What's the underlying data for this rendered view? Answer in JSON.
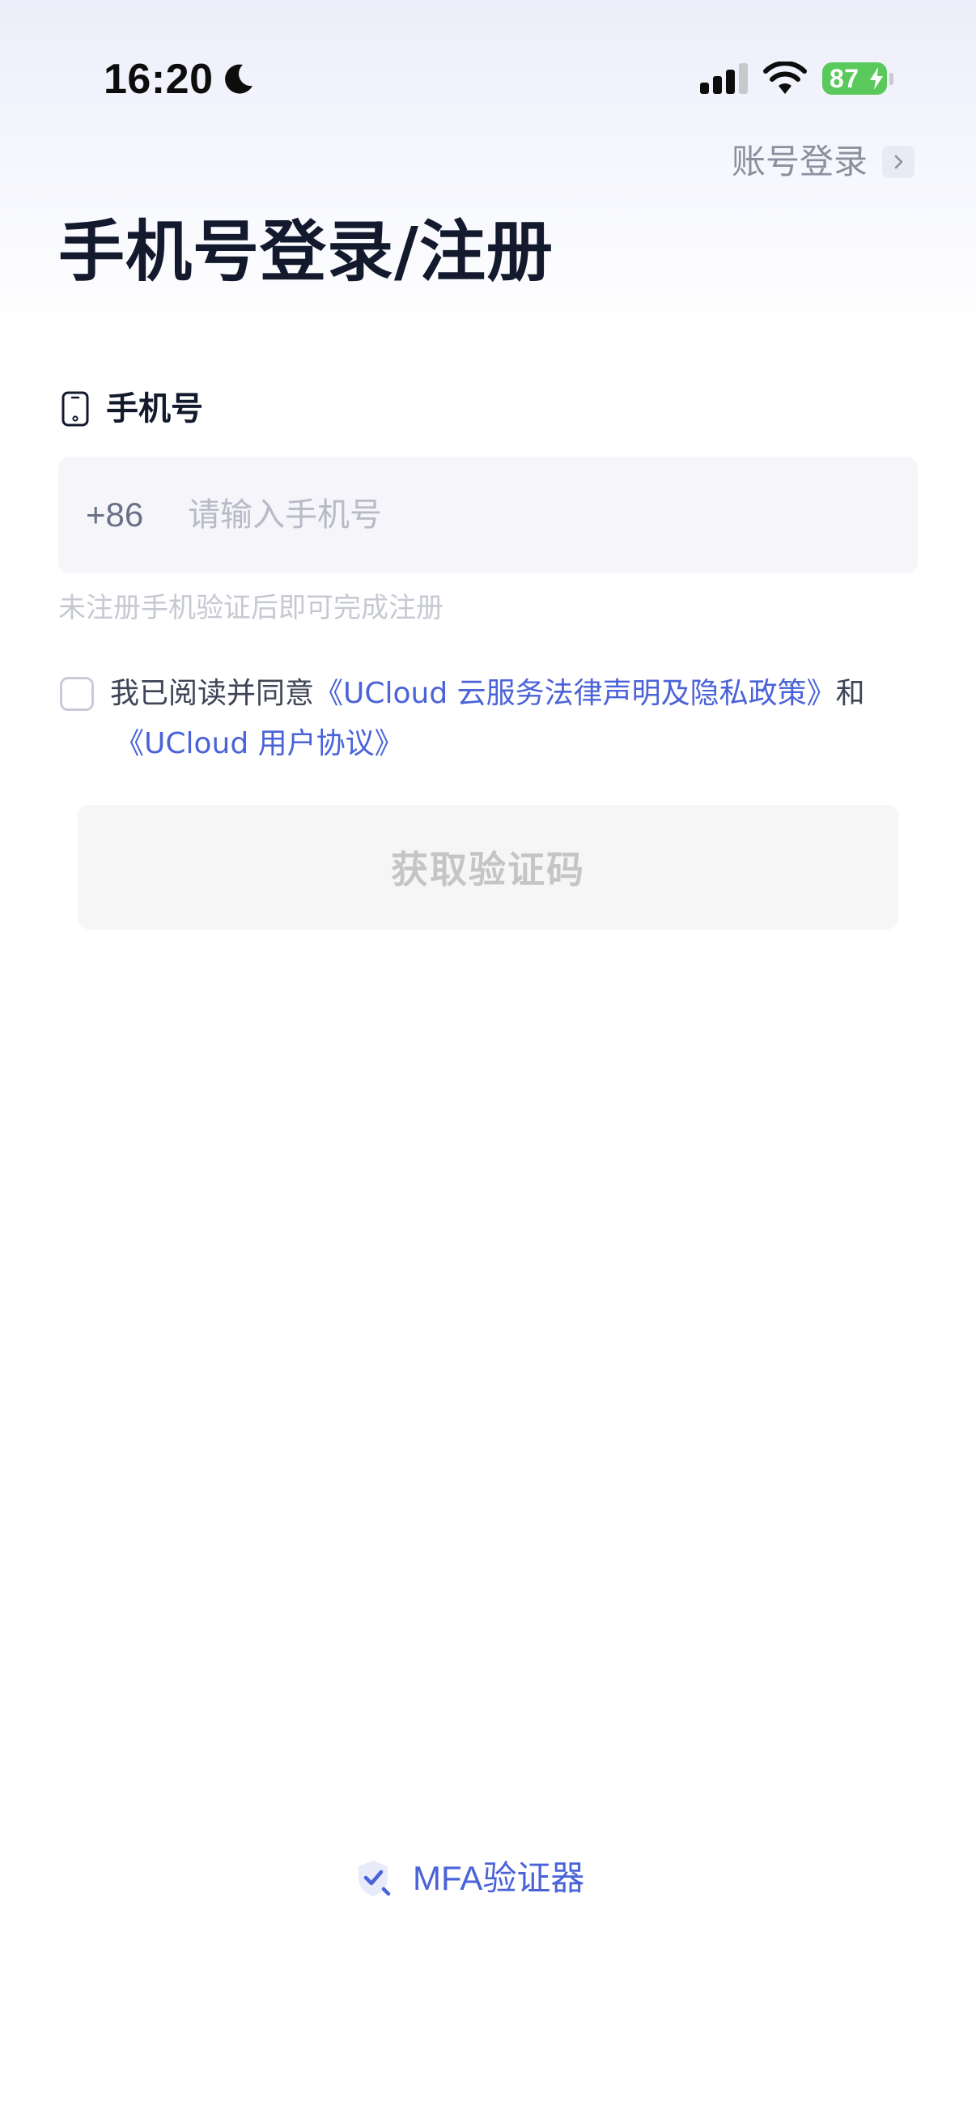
{
  "status_bar": {
    "time": "16:20",
    "battery_level": "87",
    "battery_charging": true
  },
  "header": {
    "account_login_label": "账号登录",
    "title": "手机号登录/注册"
  },
  "phone_section": {
    "label": "手机号",
    "country_code": "+86",
    "placeholder": "请输入手机号",
    "value": "",
    "hint": "未注册手机验证后即可完成注册"
  },
  "agreement": {
    "checked": false,
    "prefix": "我已阅读并同意",
    "legal_link": "《UCloud 云服务法律声明及隐私政策》",
    "conjunction": "和",
    "user_agreement_link": "《UCloud 用户协议》"
  },
  "actions": {
    "get_code_label": "获取验证码"
  },
  "footer": {
    "mfa_label": "MFA验证器"
  },
  "colors": {
    "accent": "#4a63d8",
    "title": "#131a2e",
    "battery": "#5ac95b",
    "input_bg": "#f5f5fa"
  }
}
